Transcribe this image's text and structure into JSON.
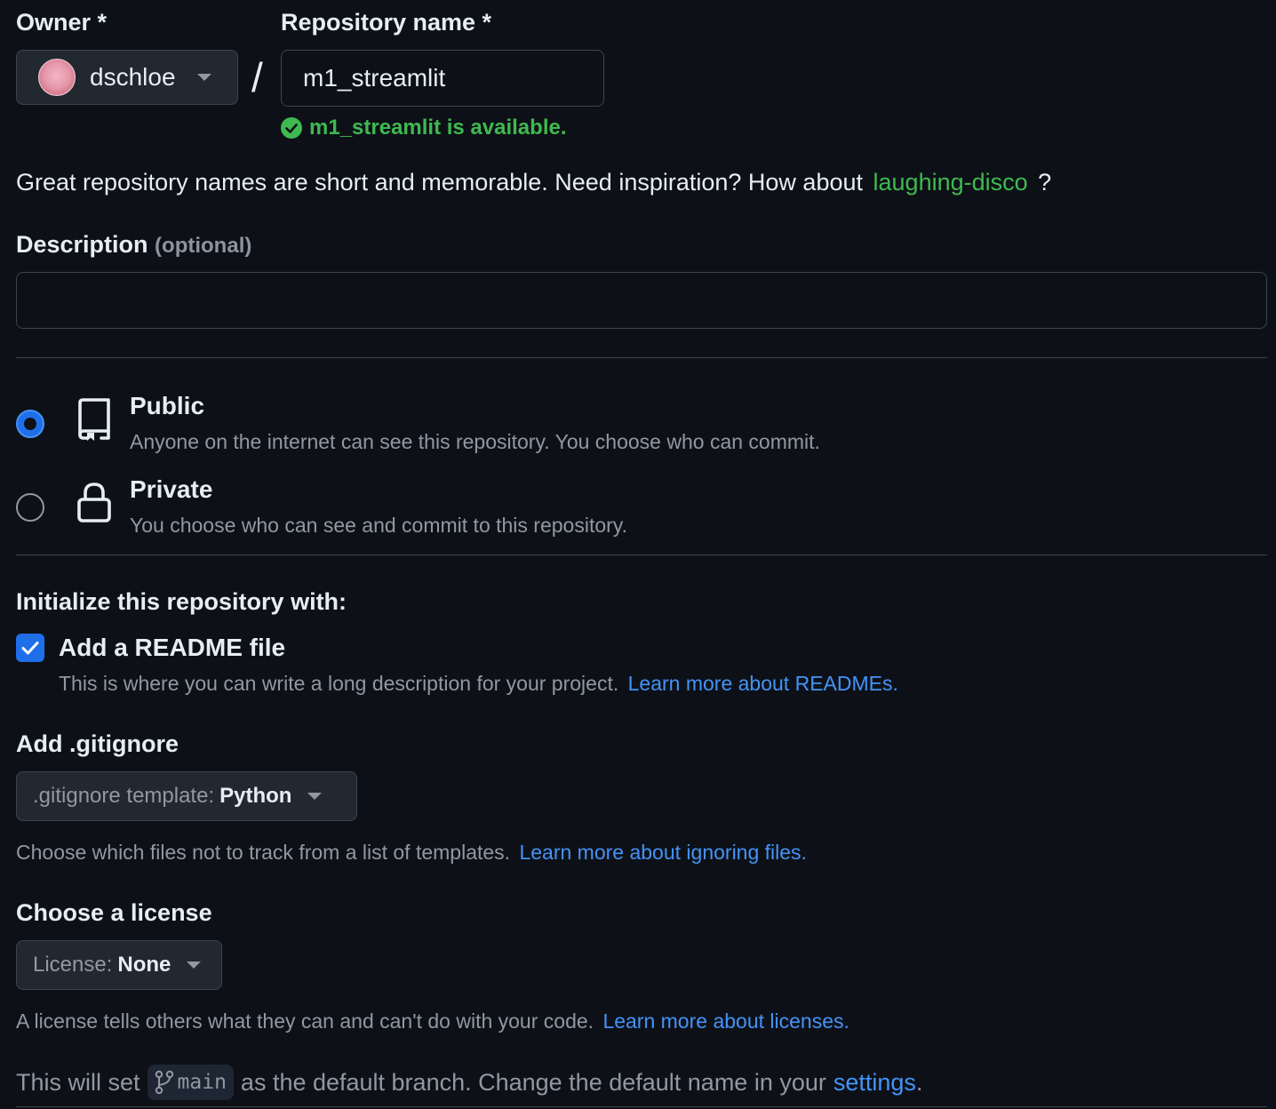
{
  "owner": {
    "label": "Owner *",
    "selected": "dschloe",
    "avatar_icon": "user-avatar"
  },
  "separator": "/",
  "repo": {
    "label": "Repository name *",
    "value": "m1_streamlit",
    "availability": "m1_streamlit is available.",
    "availability_icon": "check-circle-icon"
  },
  "inspiration": {
    "text": "Great repository names are short and memorable. Need inspiration? How about",
    "suggestion": "laughing-disco",
    "suffix": "?"
  },
  "description": {
    "label": "Description",
    "optional": "(optional)",
    "value": ""
  },
  "visibility": {
    "selected": "public",
    "options": [
      {
        "id": "public",
        "title": "Public",
        "desc": "Anyone on the internet can see this repository. You choose who can commit.",
        "icon": "repo-icon"
      },
      {
        "id": "private",
        "title": "Private",
        "desc": "You choose who can see and commit to this repository.",
        "icon": "lock-icon"
      }
    ]
  },
  "init": {
    "label": "Initialize this repository with:",
    "readme_checked": true,
    "readme_title": "Add a README file",
    "readme_desc": "This is where you can write a long description for your project.",
    "readme_link": "Learn more about READMEs."
  },
  "gitignore": {
    "label": "Add .gitignore",
    "prefix": ".gitignore template:",
    "value": "Python",
    "help": "Choose which files not to track from a list of templates.",
    "link": "Learn more about ignoring files."
  },
  "license": {
    "label": "Choose a license",
    "prefix": "License:",
    "value": "None",
    "help": "A license tells others what they can and can't do with your code.",
    "link": "Learn more about licenses."
  },
  "branch": {
    "before": "This will set",
    "name": "main",
    "after": "as the default branch. Change the default name in your",
    "link": "settings",
    "end": "."
  },
  "colors": {
    "background": "#0d1117",
    "accent": "#4493f8",
    "success": "#3fb950",
    "muted": "#9198a1"
  }
}
